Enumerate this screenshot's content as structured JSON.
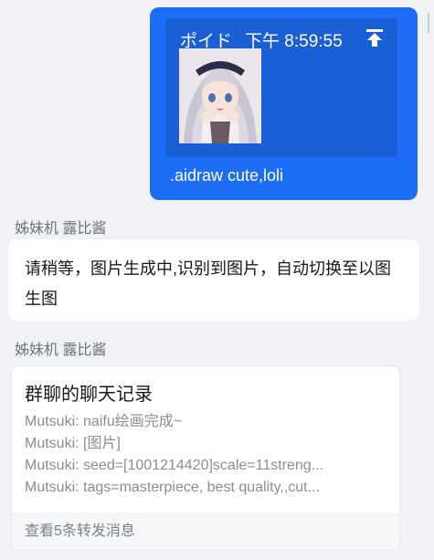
{
  "self_message": {
    "reply": {
      "sender": "ポイド",
      "time": "下午 8:59:55",
      "jump_icon": "arrow-up-to-line-icon"
    },
    "text": ".aidraw cute,loli"
  },
  "messages": [
    {
      "sender": "姊妹机 露比酱",
      "text": "请稍等，图片生成中,识别到图片，自动切换至以图生图"
    }
  ],
  "forward_card": {
    "sender": "姊妹机 露比酱",
    "title": "群聊的聊天记录",
    "lines": [
      "Mutsuki: naifu绘画完成~",
      "Mutsuki: [图片]",
      "Mutsuki: seed=[1001214420]scale=11streng...",
      "Mutsuki: tags=masterpiece, best quality,,cut..."
    ],
    "footer": "查看5条转发消息"
  },
  "colors": {
    "self_bubble": "#1e6ef5",
    "reply_box": "#1a5fd6",
    "background": "#f1f2f5"
  }
}
